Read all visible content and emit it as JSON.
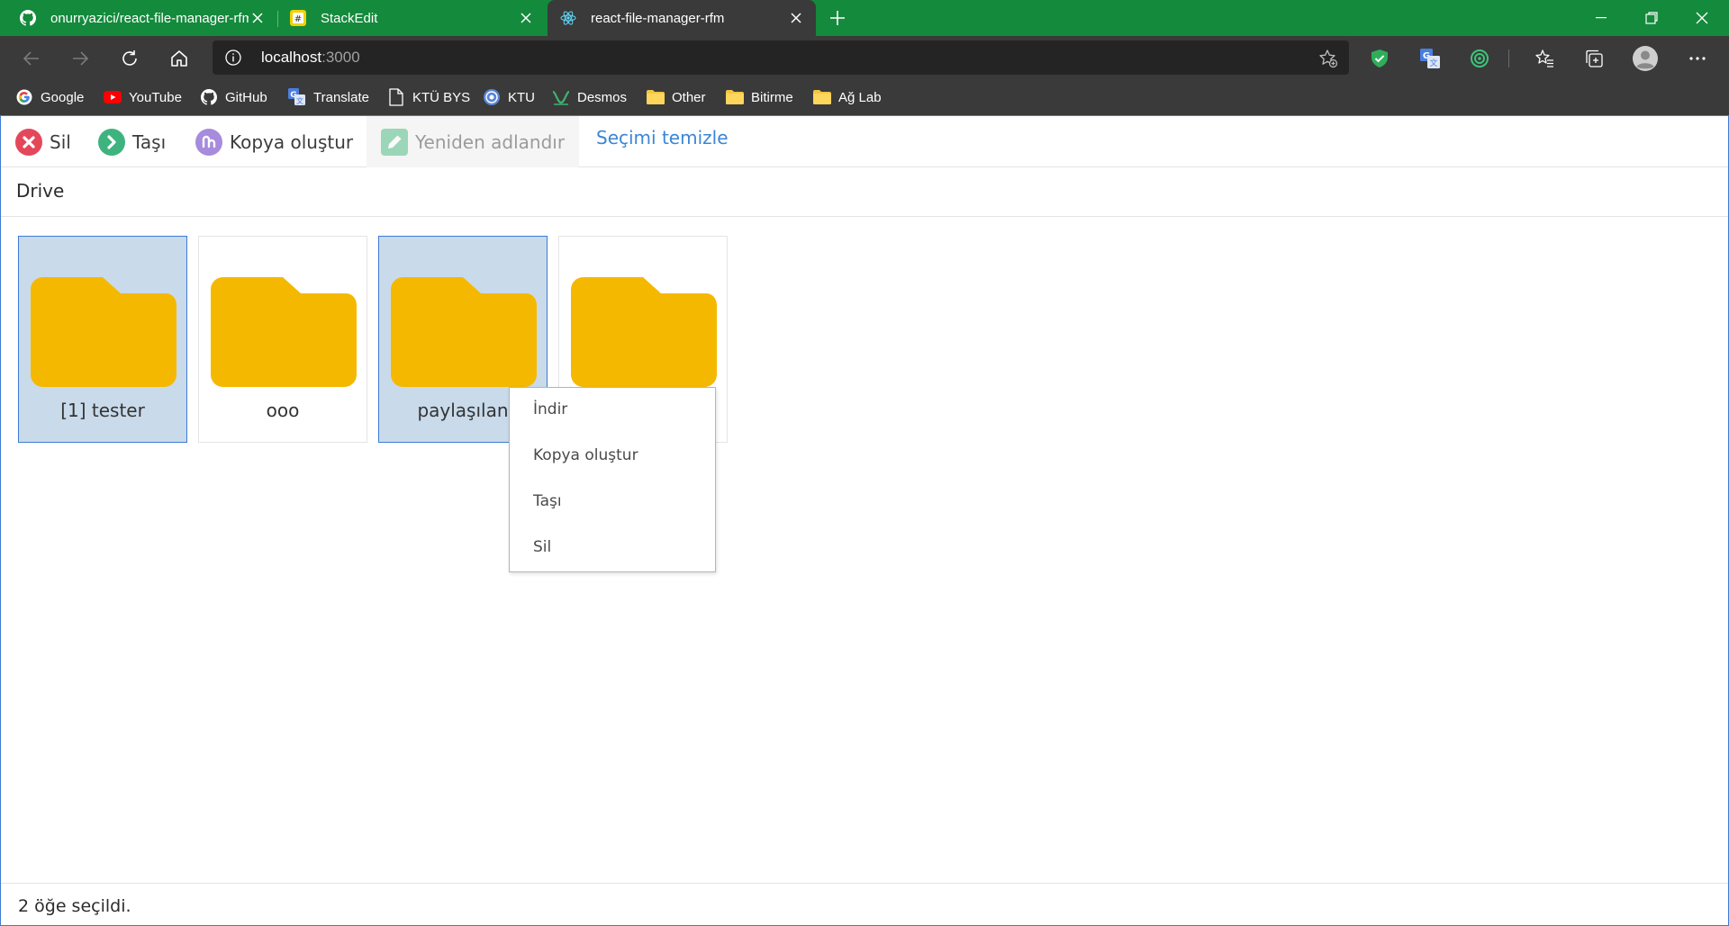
{
  "browser": {
    "tabs": [
      {
        "title": "onurryazici/react-file-manager-rfm",
        "icon": "github-icon",
        "active": false
      },
      {
        "title": "StackEdit",
        "icon": "stackedit-icon",
        "active": false
      },
      {
        "title": "react-file-manager-rfm",
        "icon": "react-icon",
        "active": true
      }
    ],
    "address": {
      "host": "localhost",
      "port": ":3000"
    },
    "bookmarks": [
      {
        "label": "Google",
        "icon": "google-icon"
      },
      {
        "label": "YouTube",
        "icon": "youtube-icon"
      },
      {
        "label": "GitHub",
        "icon": "github-icon"
      },
      {
        "label": "Translate",
        "icon": "translate-icon"
      },
      {
        "label": "KTÜ BYS",
        "icon": "document-icon"
      },
      {
        "label": "KTU",
        "icon": "ktu-icon"
      },
      {
        "label": "Desmos",
        "icon": "desmos-icon"
      },
      {
        "label": "Other",
        "icon": "folder-icon"
      },
      {
        "label": "Bitirme",
        "icon": "folder-icon"
      },
      {
        "label": "Ağ Lab",
        "icon": "folder-icon"
      }
    ],
    "colors": {
      "tabbar": "#148a3c",
      "chrome": "#3a3a3a",
      "address": "#242424"
    }
  },
  "toolbar": {
    "delete_label": "Sil",
    "move_label": "Taşı",
    "copy_label": "Kopya oluştur",
    "rename_label": "Yeniden adlandır",
    "clear_label": "Seçimi temizle"
  },
  "breadcrumb": {
    "root": "Drive"
  },
  "items": [
    {
      "name": "[1] tester",
      "selected": true
    },
    {
      "name": "ooo",
      "selected": false
    },
    {
      "name": "paylaşılan",
      "selected": true
    },
    {
      "name": "",
      "selected": false
    }
  ],
  "context_menu": {
    "items": [
      "İndir",
      "Kopya oluştur",
      "Taşı",
      "Sil"
    ]
  },
  "status": {
    "text": "2 öğe seçildi."
  },
  "colors": {
    "folder": "#f5b800",
    "selected_bg": "#c9daea",
    "accent": "#3a86d6",
    "delete": "#e5475a",
    "move": "#3fb37f",
    "copy": "#a78bdc",
    "rename": "#45b97c"
  }
}
